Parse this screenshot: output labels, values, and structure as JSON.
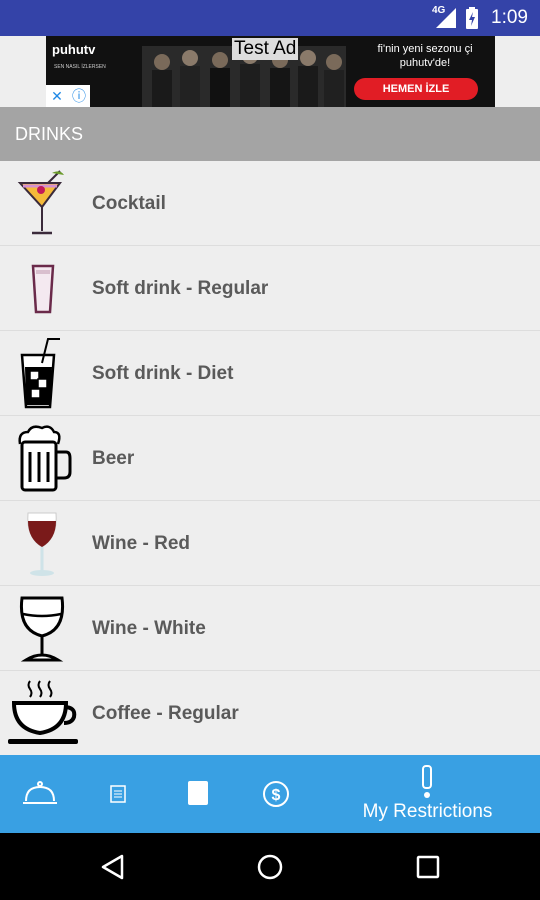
{
  "status_bar": {
    "network": "4G",
    "time": "1:09"
  },
  "ad": {
    "brand": "puhutv",
    "brand_sub": "SEN NASIL İZLERSEN",
    "badge": "Test Ad",
    "tagline": "fi'nin yeni sezonu çi puhutv'de!",
    "cta": "HEMEN İZLE",
    "adchoices_close": "✕",
    "adchoices_info": "ⓘ"
  },
  "section": {
    "title": "DRINKS"
  },
  "drinks": [
    {
      "label": "Cocktail",
      "icon": "cocktail-icon"
    },
    {
      "label": "Soft drink - Regular",
      "icon": "soft-drink-glass-icon"
    },
    {
      "label": "Soft drink - Diet",
      "icon": "soft-drink-straw-icon"
    },
    {
      "label": "Beer",
      "icon": "beer-mug-icon"
    },
    {
      "label": "Wine - Red",
      "icon": "red-wine-glass-icon"
    },
    {
      "label": "Wine - White",
      "icon": "white-wine-glass-icon"
    },
    {
      "label": "Coffee - Regular",
      "icon": "coffee-cup-icon"
    }
  ],
  "tabs": [
    {
      "icon": "cloche-icon",
      "label": ""
    },
    {
      "icon": "menu-book-icon",
      "label": ""
    },
    {
      "icon": "card-icon",
      "label": ""
    },
    {
      "icon": "dollar-icon",
      "label": ""
    },
    {
      "icon": "exclamation-icon",
      "label": "My Restrictions"
    }
  ],
  "colors": {
    "status_bar": "#3443a8",
    "tab_bar": "#39a0e3",
    "section_header": "#a4a4a4",
    "row_text": "#5a5a5a"
  }
}
